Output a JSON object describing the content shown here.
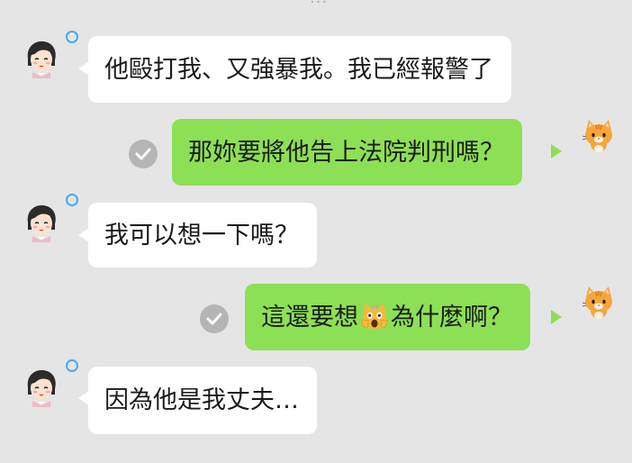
{
  "chat": {
    "messages": [
      {
        "side": "incoming",
        "text": "他毆打我、又強暴我。我已經報警了"
      },
      {
        "side": "outgoing",
        "text": "那妳要將他告上法院判刑嗎？"
      },
      {
        "side": "incoming",
        "text": "我可以想一下嗎？"
      },
      {
        "side": "outgoing",
        "text_before": "這還要想",
        "emoji": "scream-cat-emoji",
        "text_after": "為什麼啊？"
      },
      {
        "side": "incoming",
        "text": "因為他是我丈夫…"
      }
    ]
  },
  "colors": {
    "background": "#e5e5e5",
    "incoming_bubble": "#ffffff",
    "outgoing_bubble": "#8de055",
    "status_ring": "#46a9f2",
    "read_check": "#b5b5b5"
  },
  "icons": {
    "incoming_avatar": "girl-avatar-icon",
    "outgoing_avatar": "orange-cat-avatar-icon",
    "read_receipt": "read-check-icon",
    "online_status": "status-ring-icon"
  }
}
